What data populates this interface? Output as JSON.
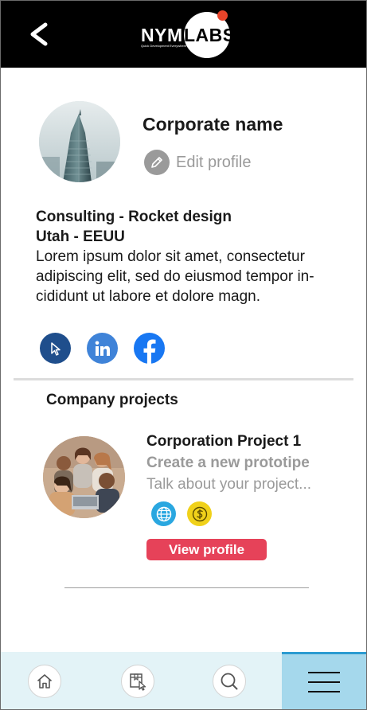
{
  "header": {
    "back_icon": "chevron-left-icon",
    "logo": {
      "left": "NYM",
      "right": "LABS",
      "tagline": "Quick Development Everywhere"
    }
  },
  "profile": {
    "name": "Corporate name",
    "edit_label": "Edit profile",
    "line1": "Consulting - Rocket design",
    "line2": "Utah - EEUU",
    "description": "Lorem ipsum dolor sit amet, consectetur adipiscing elit, sed do eiusmod tempor in-cididunt ut labore et dolore magn.",
    "socials": [
      {
        "name": "website-cursor-icon",
        "color": "#1f4e8c"
      },
      {
        "name": "linkedin-icon",
        "color": "#3f83d8"
      },
      {
        "name": "facebook-icon",
        "color": "#1877f2"
      }
    ]
  },
  "projects": {
    "title": "Company projects",
    "items": [
      {
        "title": "Corporation Project 1",
        "subtitle": "Create a new prototipe",
        "description": "Talk about your project...",
        "icons": [
          {
            "name": "globe-icon",
            "color": "#2aa7e0"
          },
          {
            "name": "dollar-coin-icon",
            "color": "#f0d11a"
          }
        ],
        "button_label": "View profile"
      }
    ]
  },
  "bottom_nav": {
    "items": [
      "home-icon",
      "bookmark-cursor-icon",
      "search-icon",
      "menu-icon"
    ],
    "active": "menu-icon"
  },
  "colors": {
    "header_bg": "#000000",
    "accent": "#e64259",
    "nav_bg": "#e3f3f7",
    "nav_active": "#a5d8ec",
    "nav_active_border": "#2b9bd1"
  }
}
